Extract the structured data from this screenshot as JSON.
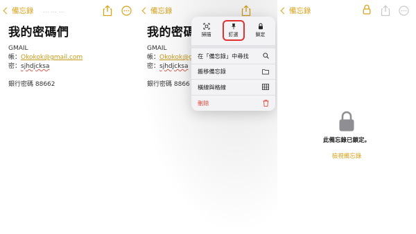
{
  "colors": {
    "accent": "#d9a21b",
    "danger": "#e0453a",
    "highlight": "#e03030"
  },
  "panel1": {
    "back_label": "備忘錄",
    "ghost_text": "...  ...  ...",
    "title": "我的密碼們",
    "lines": {
      "heading": "GMAIL",
      "account_label": "帳：",
      "account_value": "Okokok@gmail.com",
      "password_label": "密：",
      "password_value": "sjhdjcksa",
      "bank": "銀行密碼 88662"
    }
  },
  "panel2": {
    "back_label": "備忘錄",
    "title": "我的密碼們",
    "lines": {
      "heading": "GMAIL",
      "account_label": "帳：",
      "account_value": "Okokok@gmai",
      "password_label": "密：",
      "password_value": "sjhdjcksa",
      "bank": "銀行密碼 8866"
    },
    "menu": {
      "top_actions": [
        {
          "label": "掃描",
          "icon": "scan-icon"
        },
        {
          "label": "釘選",
          "icon": "pin-icon",
          "highlighted": true
        },
        {
          "label": "鎖定",
          "icon": "lock-icon"
        }
      ],
      "rows": [
        {
          "label": "在「備忘錄」中尋找",
          "icon": "search-icon"
        },
        {
          "label": "搬移備忘錄",
          "icon": "folder-icon"
        },
        {
          "label": "橫線與格線",
          "icon": "grid-icon"
        },
        {
          "label": "刪除",
          "icon": "trash-icon",
          "destructive": true
        }
      ]
    }
  },
  "panel3": {
    "back_label": "備忘錄",
    "locked_message": "此備忘錄已鎖定。",
    "view_link": "檢視備忘錄"
  }
}
